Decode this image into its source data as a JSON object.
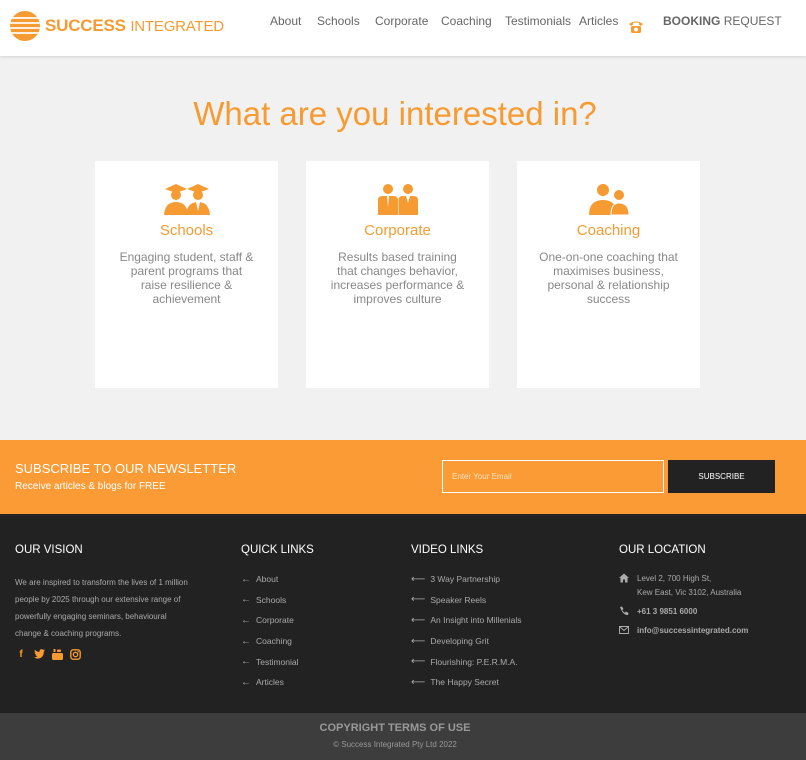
{
  "header": {
    "logo": {
      "bold": "Success",
      "light": "Integrated"
    },
    "nav": [
      {
        "id": "about",
        "label": "About"
      },
      {
        "id": "schools",
        "label": "Schools"
      },
      {
        "id": "corporate",
        "label": "Corporate"
      },
      {
        "id": "coaching",
        "label": "Coaching"
      },
      {
        "id": "testimonials",
        "label": "Testimonials"
      },
      {
        "id": "articles",
        "label": "Articles"
      }
    ],
    "phone_icon": "phone-icon",
    "booking": {
      "bold": "Booking",
      "light": "Request"
    }
  },
  "hero": {
    "title": "What are you interested in?",
    "cards": [
      {
        "title": "Schools",
        "icon": "graduates-icon",
        "description": "Engaging student, staff & parent programs that raise resilience & achievement"
      },
      {
        "title": "Corporate",
        "icon": "business-people-icon",
        "description": "Results based training that changes behavior, increases performance & improves culture"
      },
      {
        "title": "Coaching",
        "icon": "coaching-people-icon",
        "description": "One-on-one coaching that maximises business, personal & relationship success"
      }
    ]
  },
  "newsletter": {
    "title": "Subscribe to our newsletter",
    "subtitle": "Receive articles & blogs for FREE",
    "email_placeholder": "Enter Your Email",
    "button_label": "Subscribe"
  },
  "footer": {
    "vision": {
      "heading": "Our Vision",
      "text": "We are inspired to transform the lives of 1 million people by 2025 through our extensive range of powerfully engaging seminars, behavioural change & coaching programs.",
      "social": [
        "facebook-icon",
        "twitter-icon",
        "youtube-icon",
        "instagram-icon"
      ]
    },
    "quick_links": {
      "heading": "Quick Links",
      "items": [
        "About",
        "Schools",
        "Corporate",
        "Coaching",
        "Testimonial",
        "Articles"
      ]
    },
    "video_links": {
      "heading": "Video Links",
      "items": [
        "3 Way Partnership",
        "Speaker Reels",
        "An Insight into Millenials",
        "Developing Grit",
        "Flourishing: P.E.R.M.A.",
        "The Happy Secret"
      ]
    },
    "location": {
      "heading": "Our Location",
      "address_line1": "Level 2, 700 High St,",
      "address_line2": "Kew East, Vic 3102, Australia",
      "phone": "+61 3 9851 6000",
      "email": "info@successintegrated.com"
    }
  },
  "bottom": {
    "title": "Copyright Terms of Use",
    "subtitle": "© Success Integrated Pty Ltd 2022"
  },
  "colors": {
    "accent": "#f59b32",
    "footer_bg": "#222222",
    "bottom_bg": "#3d3d3d",
    "page_bg": "#f1f1f1"
  }
}
